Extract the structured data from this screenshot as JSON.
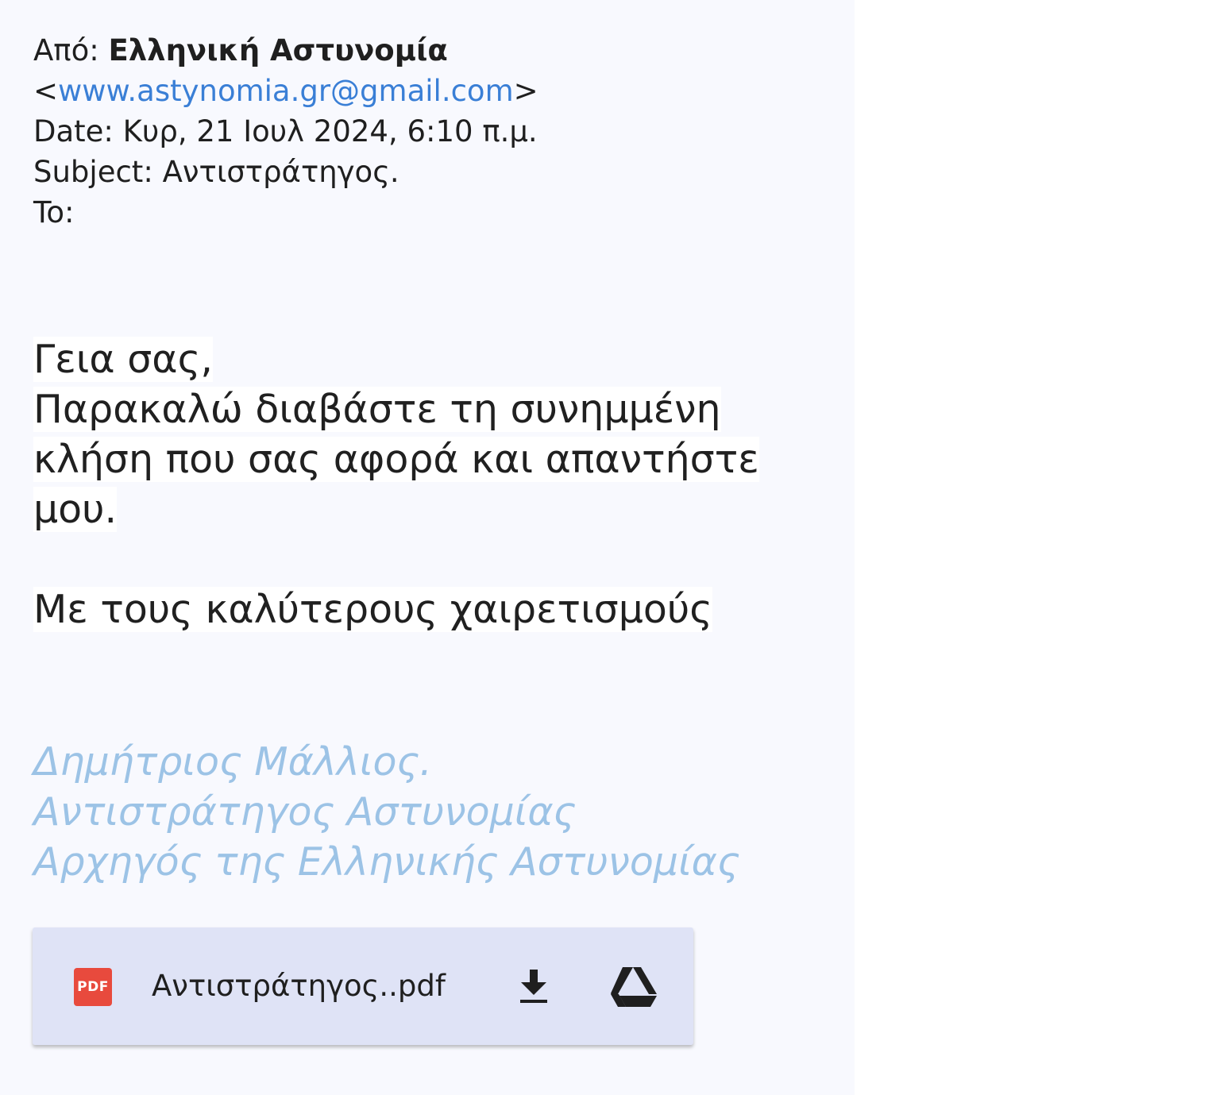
{
  "header": {
    "from_label": "Από:",
    "sender_name": "Ελληνική Αστυνομία",
    "email_open": "<",
    "sender_email": "www.astynomia.gr@gmail.com",
    "email_close": ">",
    "date_label": "Date:",
    "date_value": "Κυρ, 21 Ιουλ 2024, 6:10 π.μ.",
    "subject_label": "Subject:",
    "subject_value": "Αντιστράτηγος.",
    "to_label": "To:"
  },
  "body": {
    "greeting": "Γεια σας,",
    "line1": "Παρακαλώ διαβάστε τη συνημμένη",
    "line2": "κλήση που σας αφορά και απαντήστε",
    "line3": "μου.",
    "closing": "Με τους καλύτερους χαιρετισμούς"
  },
  "signature": {
    "name": "Δημήτριος Μάλλιος.",
    "title": "Αντιστράτηγος Αστυνομίας",
    "role": "Αρχηγός της Ελληνικής Αστυνομίας"
  },
  "attachment": {
    "badge": "PDF",
    "file_name": "Αντιστράτηγος..pdf",
    "download_icon": "download-icon",
    "drive_icon": "google-drive-icon"
  },
  "colors": {
    "panel_bg": "#f8f9fe",
    "link": "#3a7fd6",
    "signature": "#9cc3e6",
    "attachment_bg": "#dfe3f6",
    "pdf_badge": "#e84a3d"
  }
}
